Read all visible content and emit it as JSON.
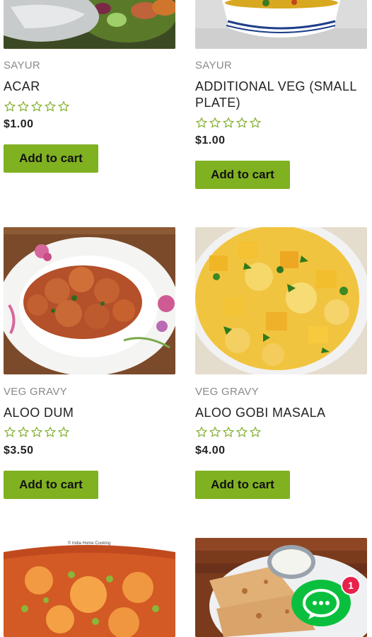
{
  "products": [
    {
      "category": "SAYUR",
      "title": "ACAR",
      "price": "$1.00",
      "rating": 0,
      "button": "Add to cart"
    },
    {
      "category": "SAYUR",
      "title": "ADDITIONAL VEG (SMALL PLATE)",
      "price": "$1.00",
      "rating": 0,
      "button": "Add to cart"
    },
    {
      "category": "VEG GRAVY",
      "title": "ALOO DUM",
      "price": "$3.50",
      "rating": 0,
      "button": "Add to cart"
    },
    {
      "category": "VEG GRAVY",
      "title": "ALOO GOBI MASALA",
      "price": "$4.00",
      "rating": 0,
      "button": "Add to cart"
    }
  ],
  "chat": {
    "badge_count": "1",
    "icon": "chat-bubble-icon"
  },
  "image_watermark": "© India Home Cooking",
  "colors": {
    "accent": "#80b121",
    "chat": "#0bbf3e",
    "badge": "#e8224b",
    "star": "#7fae2a"
  }
}
